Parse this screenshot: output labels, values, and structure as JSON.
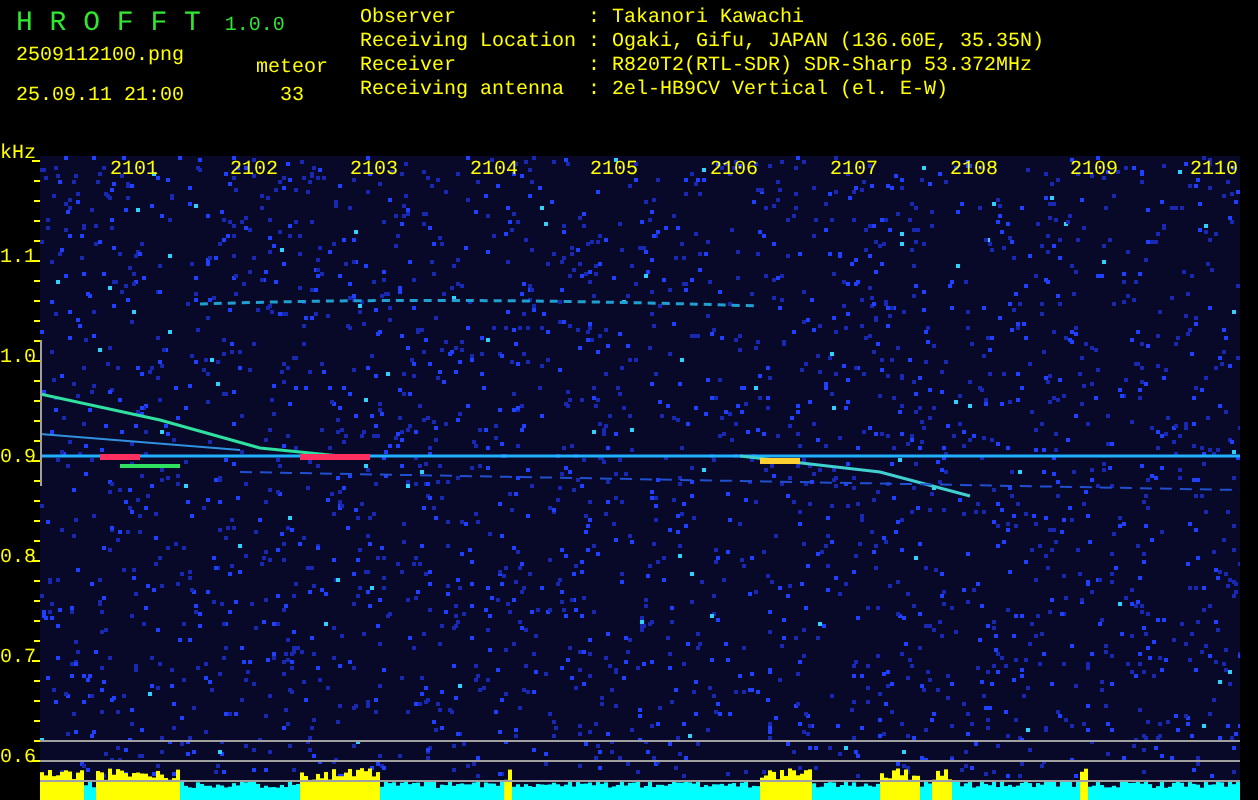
{
  "app": {
    "name": "H R O F F T",
    "version": "1.0.0"
  },
  "file": "2509112100.png",
  "timestamp": "25.09.11 21:00",
  "meteor": {
    "label": "meteor",
    "count": "33"
  },
  "station": [
    {
      "label": "Observer",
      "separator": ":",
      "value": "Takanori Kawachi"
    },
    {
      "label": "Receiving Location",
      "separator": ":",
      "value": "Ogaki, Gifu, JAPAN (136.60E, 35.35N)"
    },
    {
      "label": "Receiver",
      "separator": ":",
      "value": "R820T2(RTL-SDR) SDR-Sharp 53.372MHz"
    },
    {
      "label": "Receiving antenna",
      "separator": ":",
      "value": "2el-HB9CV Vertical (el. E-W)"
    }
  ],
  "spectrogram": {
    "y_unit": "kHz",
    "x_labels": [
      "2101",
      "2102",
      "2103",
      "2104",
      "2105",
      "2106",
      "2107",
      "2108",
      "2109",
      "2110"
    ],
    "y_labels": [
      "1.1",
      "1.0",
      "0.9",
      "0.8",
      "0.7",
      "0.6"
    ]
  }
}
